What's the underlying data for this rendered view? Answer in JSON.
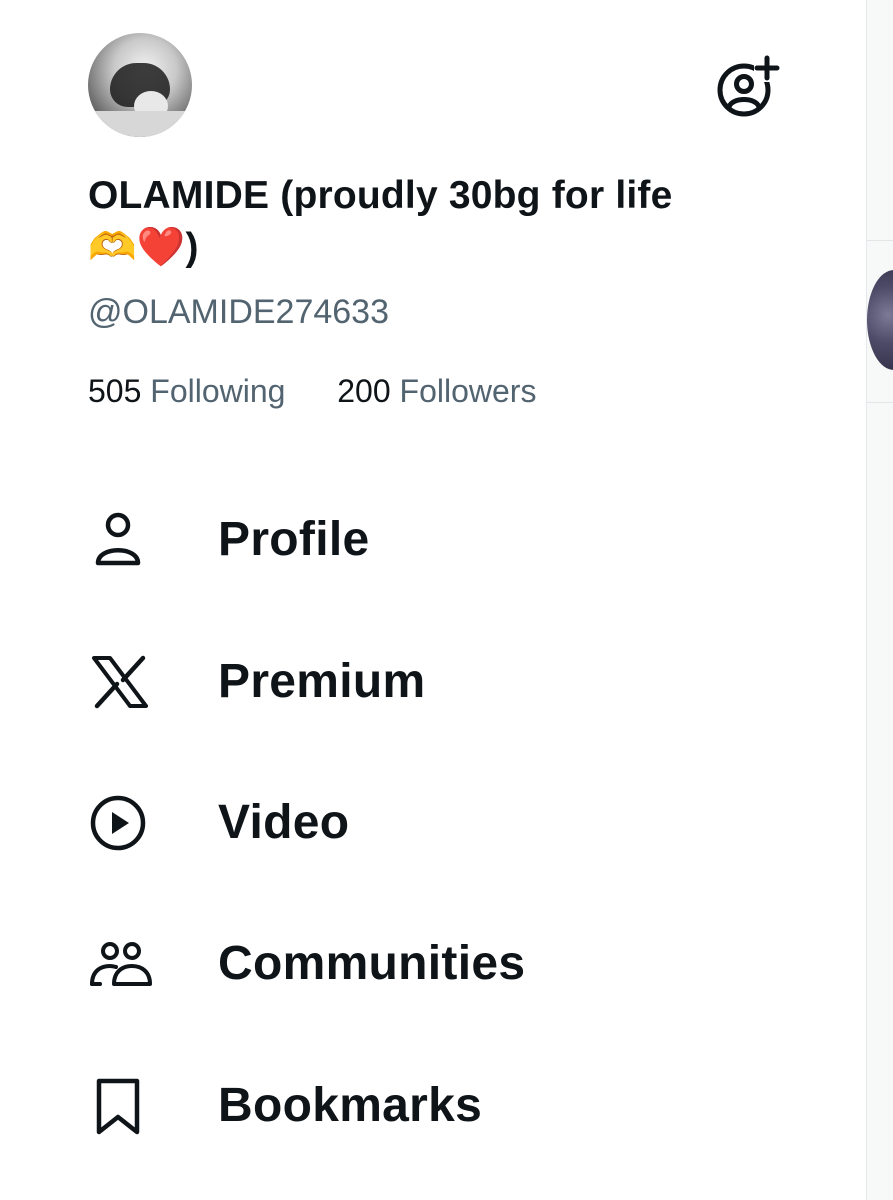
{
  "profile": {
    "display_name": "OLAMIDE (proudly 30bg for life 🫶❤️)",
    "handle": "@OLAMIDE274633",
    "following_count": "505",
    "following_label": "Following",
    "followers_count": "200",
    "followers_label": "Followers"
  },
  "actions": {
    "follow_icon": "add-user-icon"
  },
  "menu": {
    "items": [
      {
        "label": "Profile",
        "icon": "person-icon"
      },
      {
        "label": "Premium",
        "icon": "x-logo-icon"
      },
      {
        "label": "Video",
        "icon": "play-circle-icon"
      },
      {
        "label": "Communities",
        "icon": "communities-icon"
      },
      {
        "label": "Bookmarks",
        "icon": "bookmark-icon"
      }
    ]
  },
  "colors": {
    "text_primary": "#0f1419",
    "text_secondary": "#536471",
    "background": "#ffffff"
  }
}
